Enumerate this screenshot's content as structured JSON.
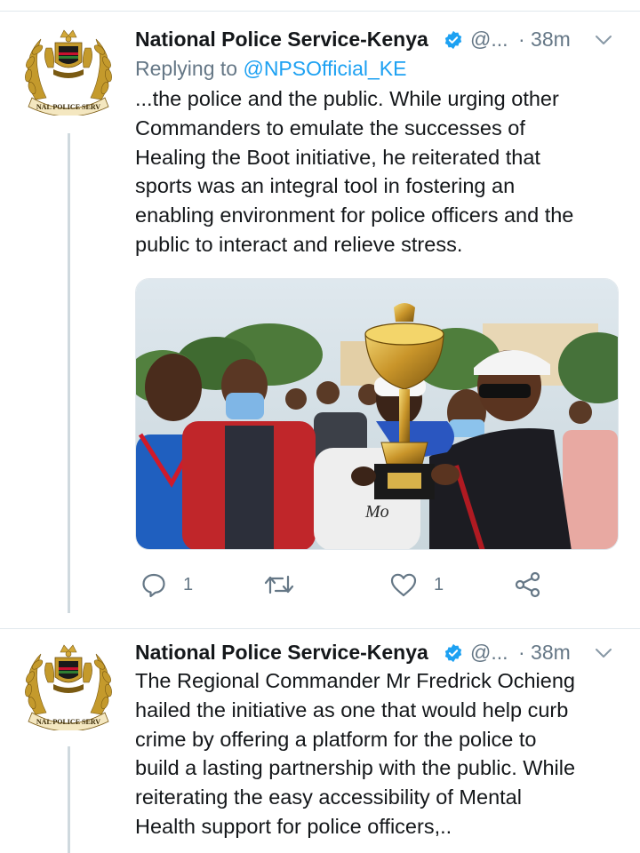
{
  "tweets": [
    {
      "author_name": "National Police Service-Kenya",
      "handle": "@...",
      "time": "· 38m",
      "replying_prefix": "Replying to ",
      "replying_handle": "@NPSOfficial_KE",
      "text": "...the police and the public. While urging other\nCommanders to emulate the successes of\nHealing the Boot initiative, he reiterated that\nsports was an integral tool in fostering an\nenabling environment for police officers and the\npublic to interact and relieve stress.",
      "media": {
        "type": "photo",
        "jersey_text": "Mo"
      },
      "actions": {
        "reply_icon": "reply-icon",
        "reply_count": "1",
        "retweet_icon": "retweet-icon",
        "retweet_count": "",
        "like_icon": "heart-icon",
        "like_count": "1",
        "share_icon": "share-icon"
      }
    },
    {
      "author_name": "National Police Service-Kenya",
      "handle": "@...",
      "time": "· 38m",
      "text": "The Regional Commander Mr Fredrick Ochieng\nhailed the initiative as one that would help curb\ncrime by offering a platform for the police to\nbuild a lasting partnership with the public. While\nreiterating the easy accessibility of Mental\nHealth support for police officers,.."
    }
  ],
  "avatar": {
    "seal_text": "NAL POLICE SERV"
  },
  "colors": {
    "accent": "#1da1f2",
    "text": "#14171a",
    "secondary": "#657786",
    "thread_line": "#cfd9de",
    "divider": "#e1e8ed"
  }
}
